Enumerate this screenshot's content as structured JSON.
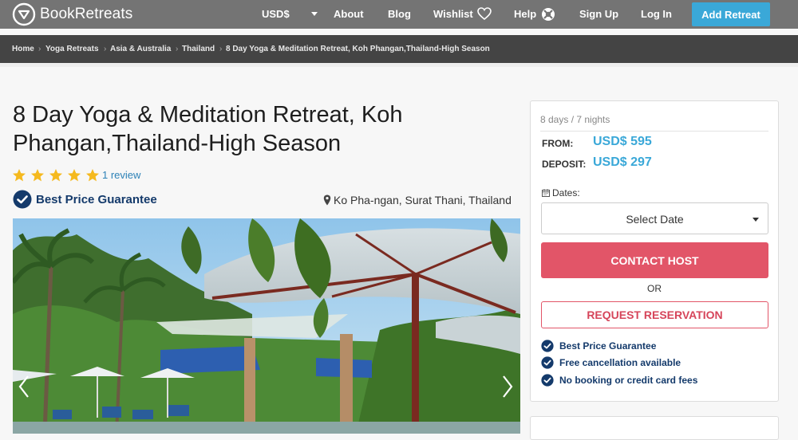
{
  "header": {
    "brand": "BookRetreats",
    "currency": "USD$",
    "nav": [
      "About",
      "Blog",
      "Wishlist",
      "Help",
      "Sign Up",
      "Log In"
    ],
    "add_retreat": "Add Retreat"
  },
  "breadcrumb": [
    "Home",
    "Yoga Retreats",
    "Asia & Australia",
    "Thailand",
    "8 Day Yoga & Meditation Retreat, Koh Phangan,Thailand-High Season"
  ],
  "listing": {
    "title": "8 Day Yoga & Meditation Retreat, Koh Phangan,Thailand-High Season",
    "rating_stars": 5,
    "reviews": "1 review",
    "best_price": "Best Price Guarantee",
    "location": "Ko Pha-ngan, Surat Thani, Thailand"
  },
  "booking": {
    "duration": "8 days / 7 nights",
    "from_label": "FROM:",
    "from_price": "USD$ 595",
    "deposit_label": "DEPOSIT:",
    "deposit_price": "USD$ 297",
    "dates_label": "Dates:",
    "select_date": "Select Date",
    "contact_host": "CONTACT HOST",
    "or": "OR",
    "request_reservation": "REQUEST RESERVATION",
    "features": [
      "Best Price Guarantee",
      "Free cancellation available",
      "No booking or credit card fees"
    ]
  },
  "colors": {
    "accent_blue": "#3aa8d8",
    "contact_red": "#e25568",
    "navy": "#143a6b",
    "star": "#f5b91e"
  }
}
